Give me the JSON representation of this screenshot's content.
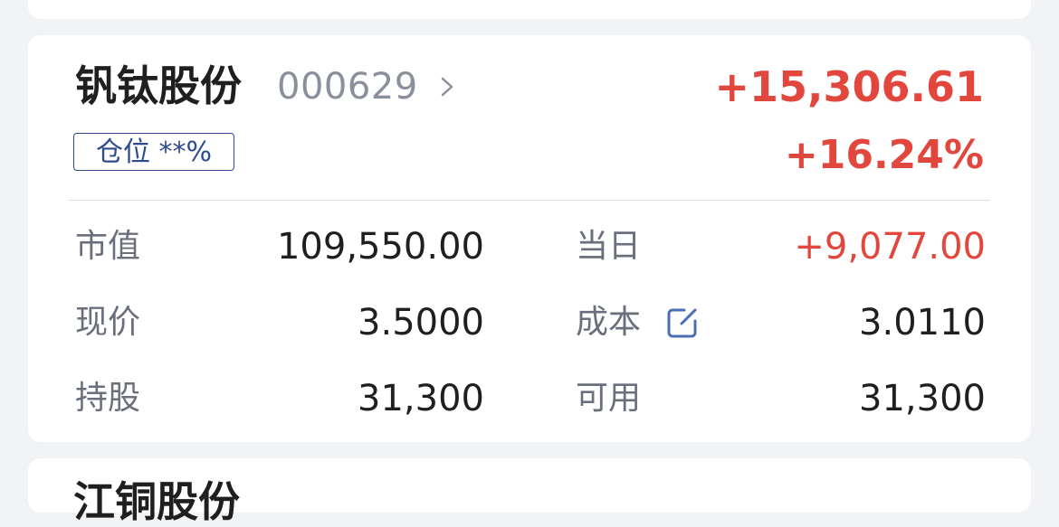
{
  "stock": {
    "name": "钒钛股份",
    "code": "000629",
    "position_badge": "仓位 **%",
    "pnl_amount": "+15,306.61",
    "pnl_percent": "+16.24%"
  },
  "metrics": {
    "market_value_label": "市值",
    "market_value": "109,550.00",
    "today_label": "当日",
    "today_value": "+9,077.00",
    "price_label": "现价",
    "price_value": "3.5000",
    "cost_label": "成本",
    "cost_value": "3.0110",
    "holding_label": "持股",
    "holding_value": "31,300",
    "available_label": "可用",
    "available_value": "31,300"
  },
  "next_card": {
    "title": "江铜股份"
  },
  "icons": {
    "chevron": "chevron-right-icon",
    "edit": "edit-icon"
  },
  "colors": {
    "gain": "#e2473e",
    "badge": "#2f4b8f",
    "edit_icon": "#4a6fb5"
  }
}
